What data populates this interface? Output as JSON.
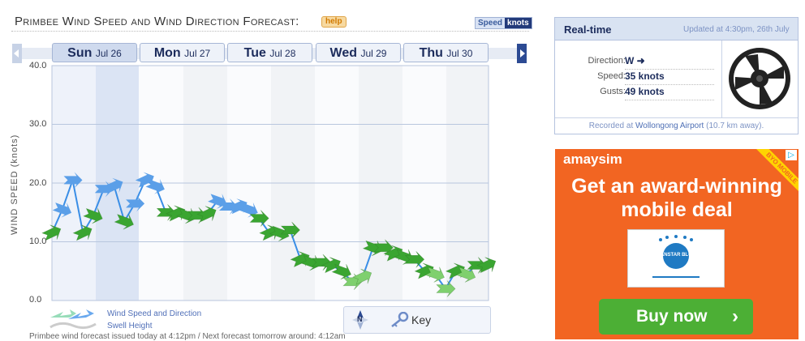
{
  "header": {
    "title": "Primbee Wind Speed and Wind Direction Forecast:",
    "help_label": "help",
    "unit_speed": "Speed",
    "unit_knots": "knots"
  },
  "day_tabs": [
    {
      "day": "Sun",
      "date": "Jul 26"
    },
    {
      "day": "Mon",
      "date": "Jul 27"
    },
    {
      "day": "Tue",
      "date": "Jul 28"
    },
    {
      "day": "Wed",
      "date": "Jul 29"
    },
    {
      "day": "Thu",
      "date": "Jul 30"
    }
  ],
  "chart": {
    "ylabel": "WIND SPEED (knots)",
    "ticks": [
      "40.0",
      "30.0",
      "20.0",
      "10.0",
      "0.0"
    ]
  },
  "chart_data": {
    "type": "line",
    "title": "",
    "xlabel": "",
    "ylabel": "WIND SPEED (knots)",
    "ylim": [
      0,
      40
    ],
    "x": [
      "Sun",
      "",
      "",
      "",
      "",
      "",
      "",
      "",
      "",
      "",
      "Mon",
      "",
      "",
      "",
      "",
      "",
      "",
      "",
      "",
      "Tue",
      "",
      "",
      "",
      "",
      "",
      "",
      "",
      "",
      "",
      "",
      "Wed",
      "",
      "",
      "",
      "",
      "",
      "",
      "",
      "",
      "",
      "Thu",
      "",
      "",
      "",
      "",
      "",
      ""
    ],
    "series": [
      {
        "name": "Wind Speed and Direction",
        "values": [
          11.5,
          15.5,
          20.5,
          11.5,
          14.5,
          19,
          19.5,
          13.5,
          16.5,
          20.5,
          19.5,
          15,
          14.8,
          14.5,
          14.5,
          14.7,
          17,
          16,
          16,
          15.5,
          14,
          11.5,
          11.5,
          12,
          7,
          6.5,
          6.5,
          6,
          5,
          3.2,
          4,
          9,
          9,
          8,
          7.5,
          7,
          5,
          4.5,
          2,
          5,
          4.5,
          6,
          6
        ]
      }
    ],
    "grid": true
  },
  "legend": {
    "wind_label": "Wind Speed and Direction",
    "swell_label": "Swell Height"
  },
  "key": {
    "label": "Key",
    "compass_letter": "N"
  },
  "footer_note": "Primbee wind forecast issued today at 4:12pm / Next forecast tomorrow around: 4:12am",
  "realtime": {
    "title": "Real-time",
    "updated": "Updated at 4:30pm, 26th July",
    "rows": [
      {
        "label": "Direction:",
        "value": "W ➜"
      },
      {
        "label": "Speed:",
        "value": "35 knots"
      },
      {
        "label": "Gusts:",
        "value": "49 knots"
      }
    ],
    "recorded_prefix": "Recorded at",
    "station": "Wollongong Airport",
    "distance": "(10.7 km away)."
  },
  "ad": {
    "brand": "amaysim",
    "banner": "BYO MOBILE",
    "headline_1": "Get an award-winning",
    "headline_2": "mobile deal",
    "badge_text": "CANSTAR BLUE",
    "cta": "Buy now",
    "colors": {
      "background": "#f26522",
      "cta": "#4caf35"
    }
  }
}
